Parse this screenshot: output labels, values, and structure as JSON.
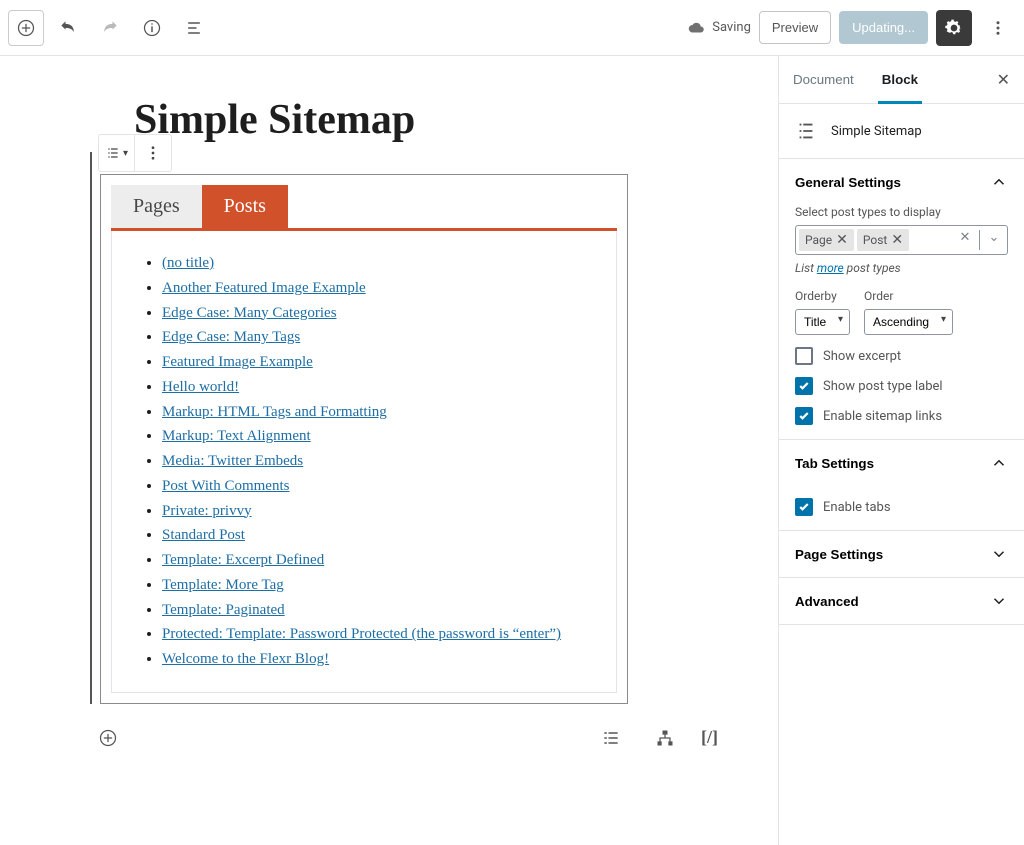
{
  "topbar": {
    "saving_label": "Saving",
    "preview_label": "Preview",
    "updating_label": "Updating..."
  },
  "post": {
    "title": "Simple Sitemap"
  },
  "sitemap": {
    "tabs": {
      "pages": "Pages",
      "posts": "Posts"
    },
    "active_tab": "posts",
    "items": [
      "(no title)",
      "Another Featured Image Example",
      "Edge Case: Many Categories",
      "Edge Case: Many Tags",
      "Featured Image Example",
      "Hello world!",
      "Markup: HTML Tags and Formatting",
      "Markup: Text Alignment",
      "Media: Twitter Embeds",
      "Post With Comments",
      "Private: privvy",
      "Standard Post",
      "Template: Excerpt Defined",
      "Template: More Tag",
      "Template: Paginated",
      "Protected: Template: Password Protected (the password is “enter”)",
      "Welcome to the Flexr Blog!"
    ]
  },
  "footer": {
    "shortcode": "[/]"
  },
  "sidebar": {
    "tabs": {
      "document": "Document",
      "block": "Block"
    },
    "block_name": "Simple Sitemap",
    "general": {
      "title": "General Settings",
      "select_label": "Select post types to display",
      "tokens": [
        "Page",
        "Post"
      ],
      "help_prefix": "List ",
      "help_link": "more",
      "help_suffix": " post types",
      "orderby_label": "Orderby",
      "orderby_value": "Title",
      "order_label": "Order",
      "order_value": "Ascending",
      "show_excerpt": "Show excerpt",
      "show_post_type_label": "Show post type label",
      "enable_links": "Enable sitemap links"
    },
    "tabsettings": {
      "title": "Tab Settings",
      "enable_tabs": "Enable tabs"
    },
    "page_settings_title": "Page Settings",
    "advanced_title": "Advanced"
  }
}
